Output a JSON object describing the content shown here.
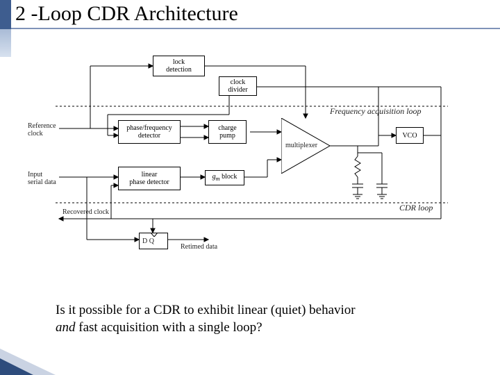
{
  "slide": {
    "title": "2 -Loop CDR Architecture",
    "caption_line1": "Is it possible for a CDR to exhibit linear (quiet) behavior",
    "caption_and": "and",
    "caption_line2": " fast acquisition with a single loop?"
  },
  "diagram": {
    "blocks": {
      "lock_detection": "lock\ndetection",
      "clock_divider": "clock\ndivider",
      "pfd": "phase/frequency\ndetector",
      "charge_pump": "charge\npump",
      "linear_pd": "linear\nphase detector",
      "gm_block": "gm block",
      "multiplexer": "multiplexer",
      "vco": "VCO"
    },
    "labels": {
      "reference_clock": "Reference\nclock",
      "input_serial_data": "Input\nserial data",
      "recovered_clock": "Recovered clock",
      "retimed_data": "Retimed data",
      "freq_loop": "Frequency acquisition loop",
      "cdr_loop": "CDR loop",
      "dq": "D   Q"
    }
  }
}
